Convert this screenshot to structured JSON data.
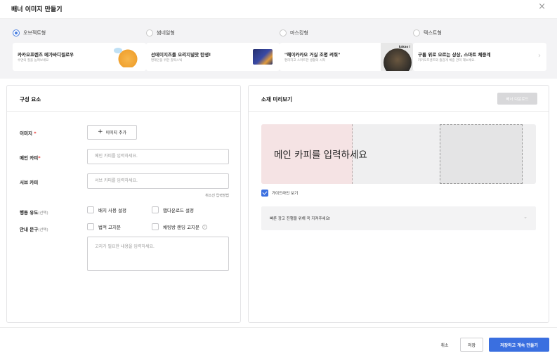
{
  "header": {
    "title": "배너 이미지 만들기",
    "close_icon": "×"
  },
  "types": [
    {
      "label": "오브젝트형",
      "selected": true,
      "card_title": "카카오프렌즈 메가바디필로우",
      "card_sub": "수면의 질을 높여보세요"
    },
    {
      "label": "썸네일형",
      "selected": false,
      "card_title": "선데이지즈를 오리지널맛 탄생!",
      "card_sub": "편데인을 위한 찰떡스넥"
    },
    {
      "label": "마스킹형",
      "selected": false,
      "card_title": "\"헤이카카오 거실 조명 켜줘\"",
      "card_sub": "편리하고 스마트한 생활의 시작",
      "thumb_text": "kakao i"
    },
    {
      "label": "텍스트형",
      "selected": false,
      "card_title": "구름 위로 오르는 상상, 스마트 체중계",
      "card_sub": "카카오프렌즈와 즐겁게 체중 관리 해보세요."
    }
  ],
  "types_next_icon": "›",
  "left_panel": {
    "title": "구성 요소",
    "image_label": "이미지",
    "required_mark": "*",
    "add_image_button": "이미지 추가",
    "plus_icon": "+",
    "main_copy_label": "메인 카피",
    "main_copy_placeholder": "메인 카피를 입력하세요.",
    "sub_copy_label": "서브 카피",
    "sub_copy_placeholder": "서브 카피를 입력하세요.",
    "strike_hint": "취소선 입력방법",
    "action_label": "행동 유도",
    "optional_mark": "(선택)",
    "badge_checkbox": "배지 사용 설정",
    "app_download_checkbox": "앱다운로드 설정",
    "notice_label": "안내 문구",
    "legal_notice_checkbox": "법적 고지문",
    "chat_landing_checkbox": "채팅방 랜딩 고지문",
    "info_icon": "?",
    "notice_placeholder": "고지가 필요한 내용을 입력하세요."
  },
  "right_panel": {
    "title": "소재 미리보기",
    "download_button": "배너 다운로드",
    "preview_main_text": "메인 카피를 입력하세요",
    "guideline_checkbox": "가이드라인 보기",
    "guideline_checked": true,
    "accordion_text": "빠른 광고 진행을 위해 꼭 지켜주세요!",
    "chevron_icon": "⌄"
  },
  "footer": {
    "cancel": "취소",
    "save": "저장",
    "save_continue": "저장하고 계속 만들기"
  },
  "colors": {
    "primary": "#3a6fe0",
    "required": "#e5322d",
    "preview_pink": "#f5e3e4"
  }
}
